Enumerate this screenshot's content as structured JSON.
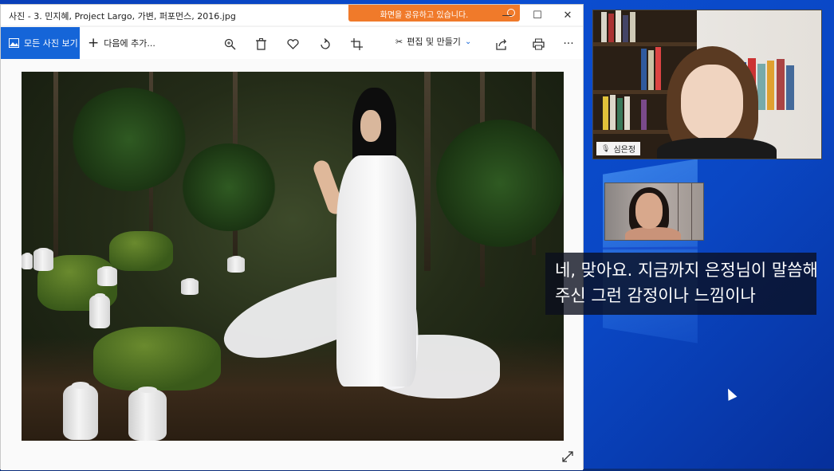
{
  "photos_app": {
    "title": "사진 - 3. 민지혜, Project Largo, 가변, 퍼포먼스, 2016.jpg",
    "share_banner": "화면을 공유하고 있습니다.",
    "window_controls": {
      "minimize": "—",
      "maximize": "☐",
      "close": "✕"
    },
    "toolbar": {
      "all_photos": "모든 사진 보기",
      "add_to": "다음에 추가...",
      "edit_create": "편집 및 만들기",
      "more": "···"
    },
    "icons": {
      "all_photos": "image-icon",
      "add": "plus-icon",
      "zoom": "zoom-in-icon",
      "delete": "trash-icon",
      "favorite": "heart-icon",
      "rotate": "rotate-icon",
      "crop": "crop-icon",
      "edit": "edit-create-icon",
      "share": "share-icon",
      "print": "print-icon",
      "more": "more-icon",
      "expand": "expand-icon"
    }
  },
  "video_call": {
    "main_participant_name": "심은정"
  },
  "subtitle": {
    "line1": "네, 맞아요. 지금까지 은정님이 말씀해",
    "line2": "주신 그런 감정이나 느낌이나"
  },
  "colors": {
    "accent": "#1565d8",
    "share_banner": "#f07a2a",
    "desktop": "#0b4ed1"
  }
}
